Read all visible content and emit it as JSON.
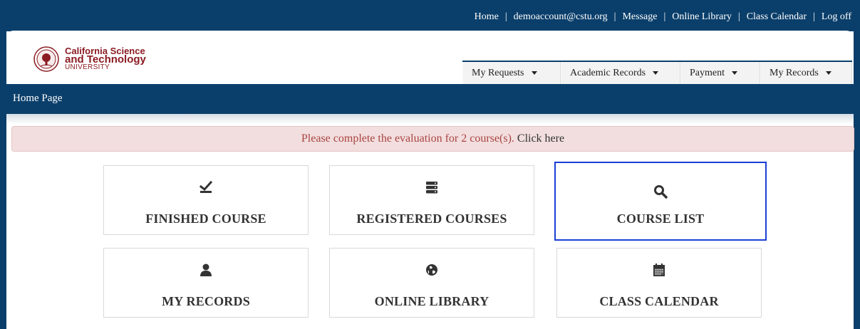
{
  "top_nav": {
    "home": "Home",
    "account": "demoaccount@cstu.org",
    "message": "Message",
    "online_library": "Online Library",
    "class_calendar": "Class Calendar",
    "log_off": "Log off",
    "separator": "|"
  },
  "brand": {
    "line1": "California Science",
    "line2": "and Technology",
    "line3": "UNIVERSITY",
    "color": "#8b1c22"
  },
  "menus": [
    {
      "label": "My Requests"
    },
    {
      "label": "Academic Records"
    },
    {
      "label": "Payment"
    },
    {
      "label": "My Records"
    }
  ],
  "page_title": "Home Page",
  "alert": {
    "message": "Please complete the evaluation for 2 course(s).",
    "link": "Click here"
  },
  "tiles": [
    {
      "label": "FINISHED COURSE",
      "icon": "check-icon"
    },
    {
      "label": "REGISTERED COURSES",
      "icon": "server-icon"
    },
    {
      "label": "COURSE LIST",
      "icon": "search-icon"
    },
    {
      "label": "MY RECORDS",
      "icon": "user-icon"
    },
    {
      "label": "ONLINE LIBRARY",
      "icon": "globe-icon"
    },
    {
      "label": "CLASS CALENDAR",
      "icon": "calendar-icon"
    }
  ],
  "colors": {
    "navy": "#0b3f6b",
    "alert_bg": "#f2dede",
    "alert_text": "#a94442",
    "focus": "#1a3fd6"
  }
}
